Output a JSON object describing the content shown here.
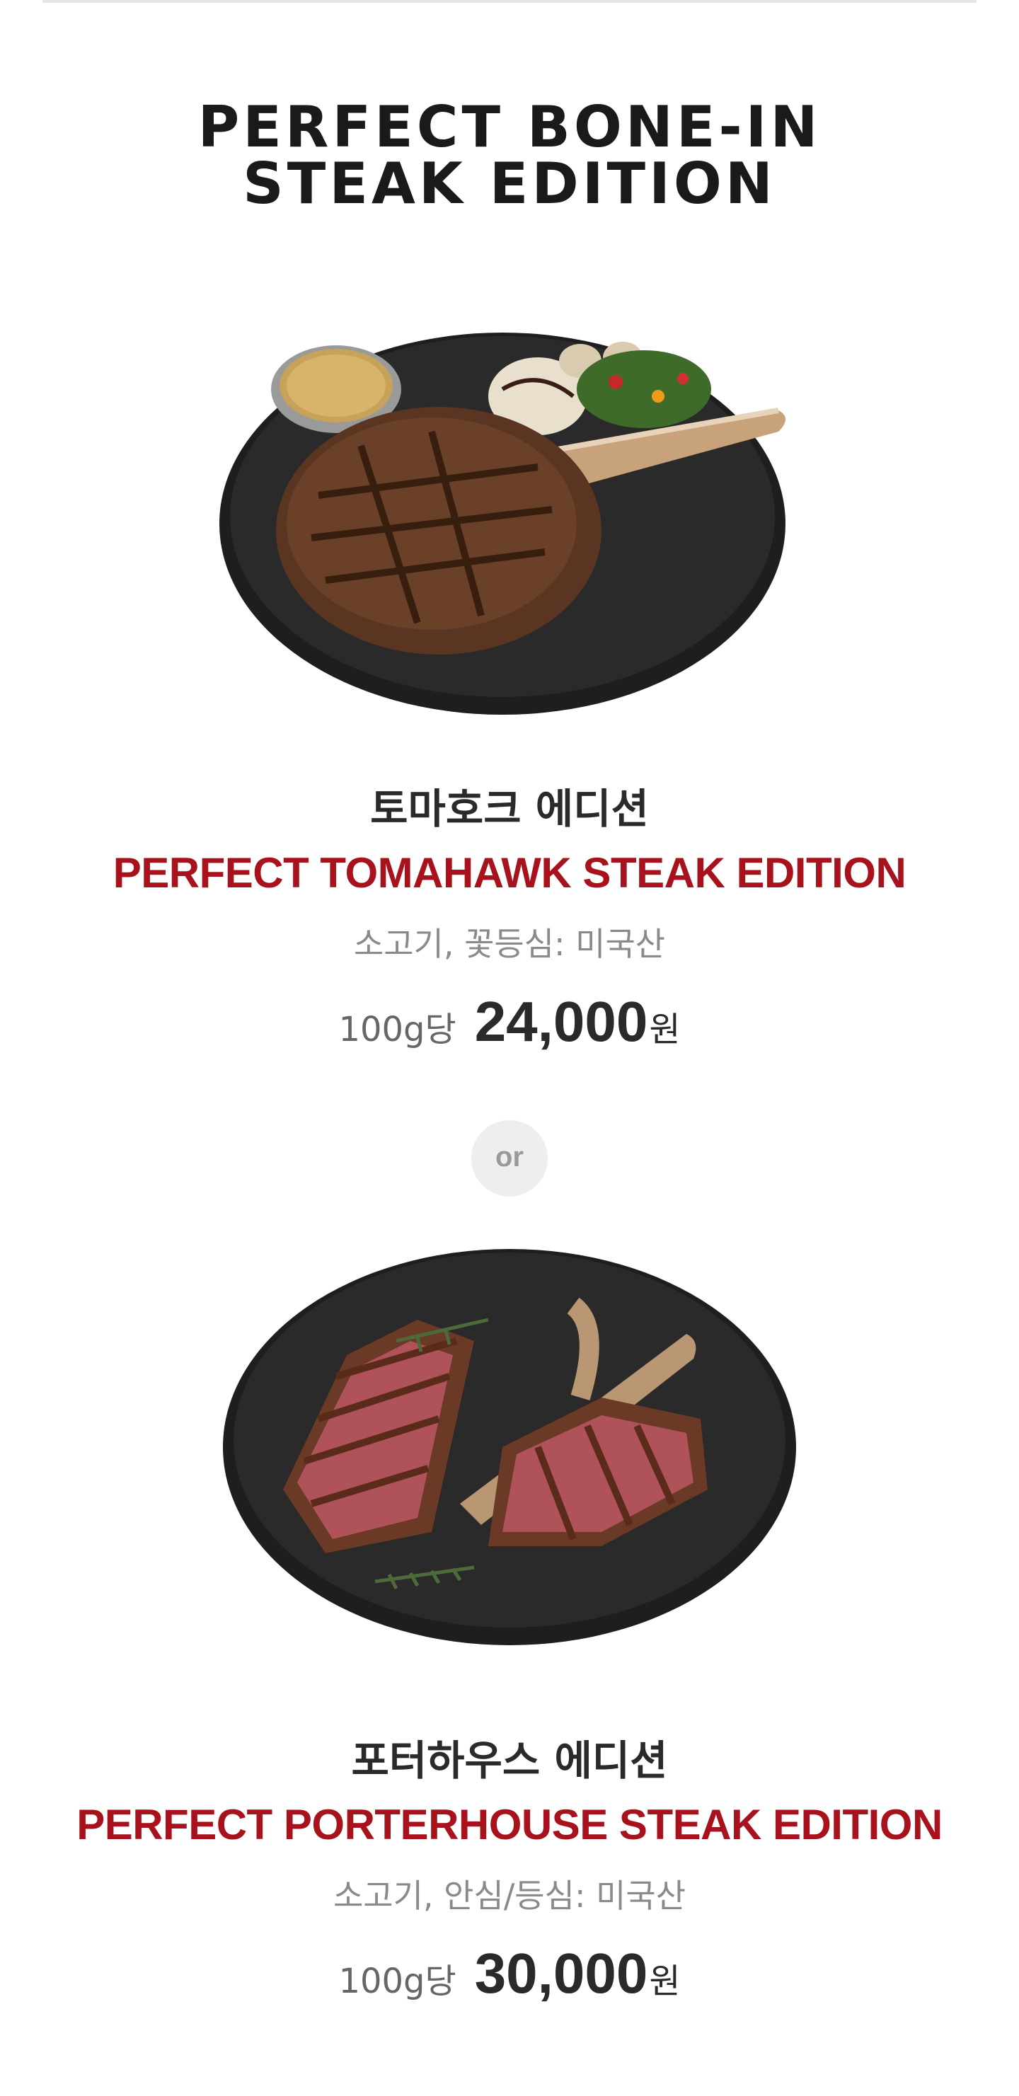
{
  "section": {
    "title_line1": "PERFECT BONE-IN",
    "title_line2": "STEAK EDITION"
  },
  "products": [
    {
      "name_kr": "토마호크 에디션",
      "name_en": "PERFECT TOMAHAWK STEAK EDITION",
      "origin": "소고기, 꽃등심: 미국산",
      "per_unit": "100g당",
      "price": "24,000",
      "currency": "원",
      "image_icon": "tomahawk-steak-plate-image"
    },
    {
      "name_kr": "포터하우스 에디션",
      "name_en": "PERFECT PORTERHOUSE STEAK EDITION",
      "origin": "소고기, 안심/등심: 미국산",
      "per_unit": "100g당",
      "price": "30,000",
      "currency": "원",
      "image_icon": "porterhouse-steak-plate-image"
    }
  ],
  "separator": {
    "label": "or"
  },
  "colors": {
    "accent_red": "#a8121d",
    "title_dark": "#1a1a1a",
    "origin_gray": "#8a8a8a",
    "badge_bg": "#eeeeee"
  }
}
